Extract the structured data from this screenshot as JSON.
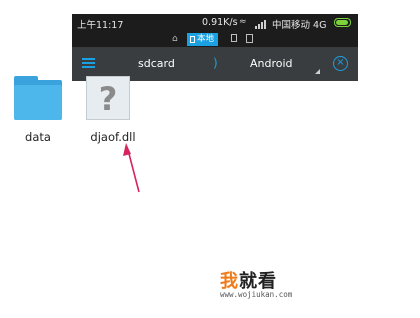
{
  "status_bar": {
    "time": "上午11:17",
    "speed": "0.91K/s",
    "carrier": "中国移动 4G"
  },
  "storage_bar": {
    "local_label": "本地"
  },
  "path_bar": {
    "crumbs": [
      "sdcard",
      "Android"
    ],
    "separator": ")"
  },
  "files": [
    {
      "name": "data",
      "icon": "folder-icon"
    },
    {
      "name": "djaof.dll",
      "icon": "unknown-file-icon"
    }
  ],
  "watermark": {
    "title_accent": "我",
    "title_rest": "就看",
    "url": "www.wojiukan.com"
  },
  "colors": {
    "accent": "#1ba0e2",
    "folder": "#4db6ea",
    "arrow": "#d6245c",
    "battery": "#7cd23b",
    "watermark_accent": "#ef7b1a"
  }
}
